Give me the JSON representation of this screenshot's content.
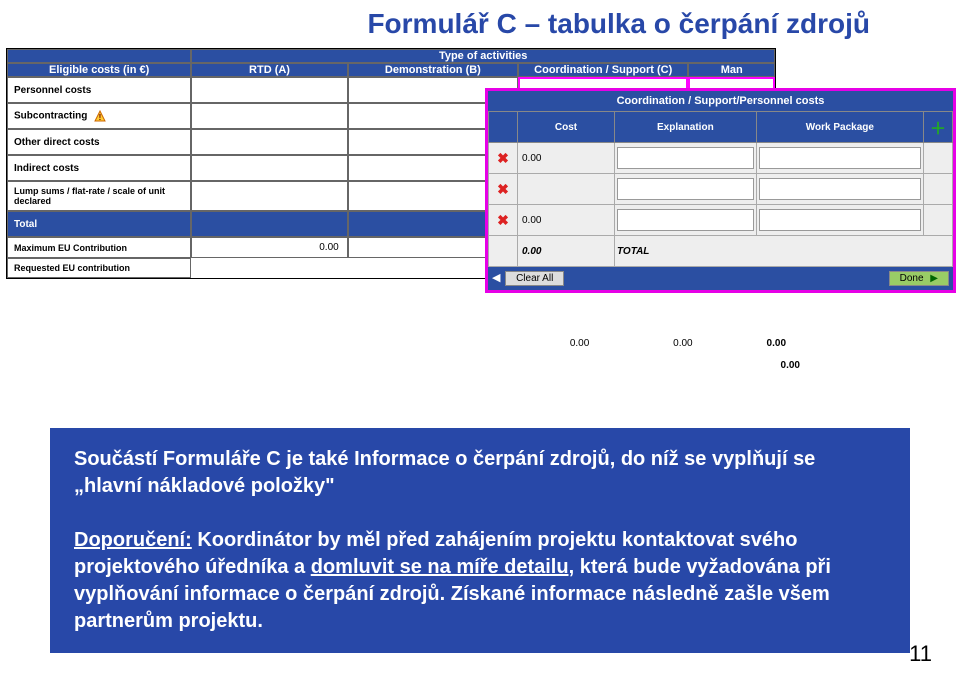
{
  "title": "Formulář C – tabulka o čerpání zdrojů",
  "bg": {
    "typeOfActivities": "Type of activities",
    "eligible": "Eligible costs (in €)",
    "cols": [
      "RTD (A)",
      "Demonstration (B)",
      "Coordination / Support (C)",
      "Man"
    ],
    "rows": [
      "Personnel costs",
      "Subcontracting",
      "Other direct costs",
      "Indirect costs",
      "Lump sums / flat-rate / scale of unit declared",
      "Total",
      "Maximum EU Contribution",
      "Requested EU contribution"
    ],
    "maxvals": [
      "0.00",
      "0.00",
      "0.00",
      "0.00",
      "0.00",
      "0.00",
      "0.00"
    ],
    "reqval": "0.00"
  },
  "panel": {
    "title": "Coordination / Support/Personnel costs",
    "cols": [
      "Cost",
      "Explanation",
      "Work Package"
    ],
    "rows": [
      {
        "cost": "0.00"
      },
      {
        "cost": ""
      },
      {
        "cost": "0.00"
      }
    ],
    "totalVal": "0.00",
    "totalLabel": "TOTAL",
    "clear": "Clear All",
    "done": "Done"
  },
  "text": {
    "p1a": "Součástí Formuláře C je také Informace o čerpání zdrojů, do níž se vyplňují se „hlavní nákladové položky\"",
    "rec": "Doporučení:",
    "p2a": " Koordinátor by měl před zahájením projektu kontaktovat svého projektového úředníka a ",
    "p2u": "domluvit se na míře detailu,",
    "p2b": " která bude vyžadována při vyplňování informace o čerpání zdrojů. ",
    "p3": "Získané informace následně zašle všem partnerům projektu."
  },
  "pageNumber": "11"
}
